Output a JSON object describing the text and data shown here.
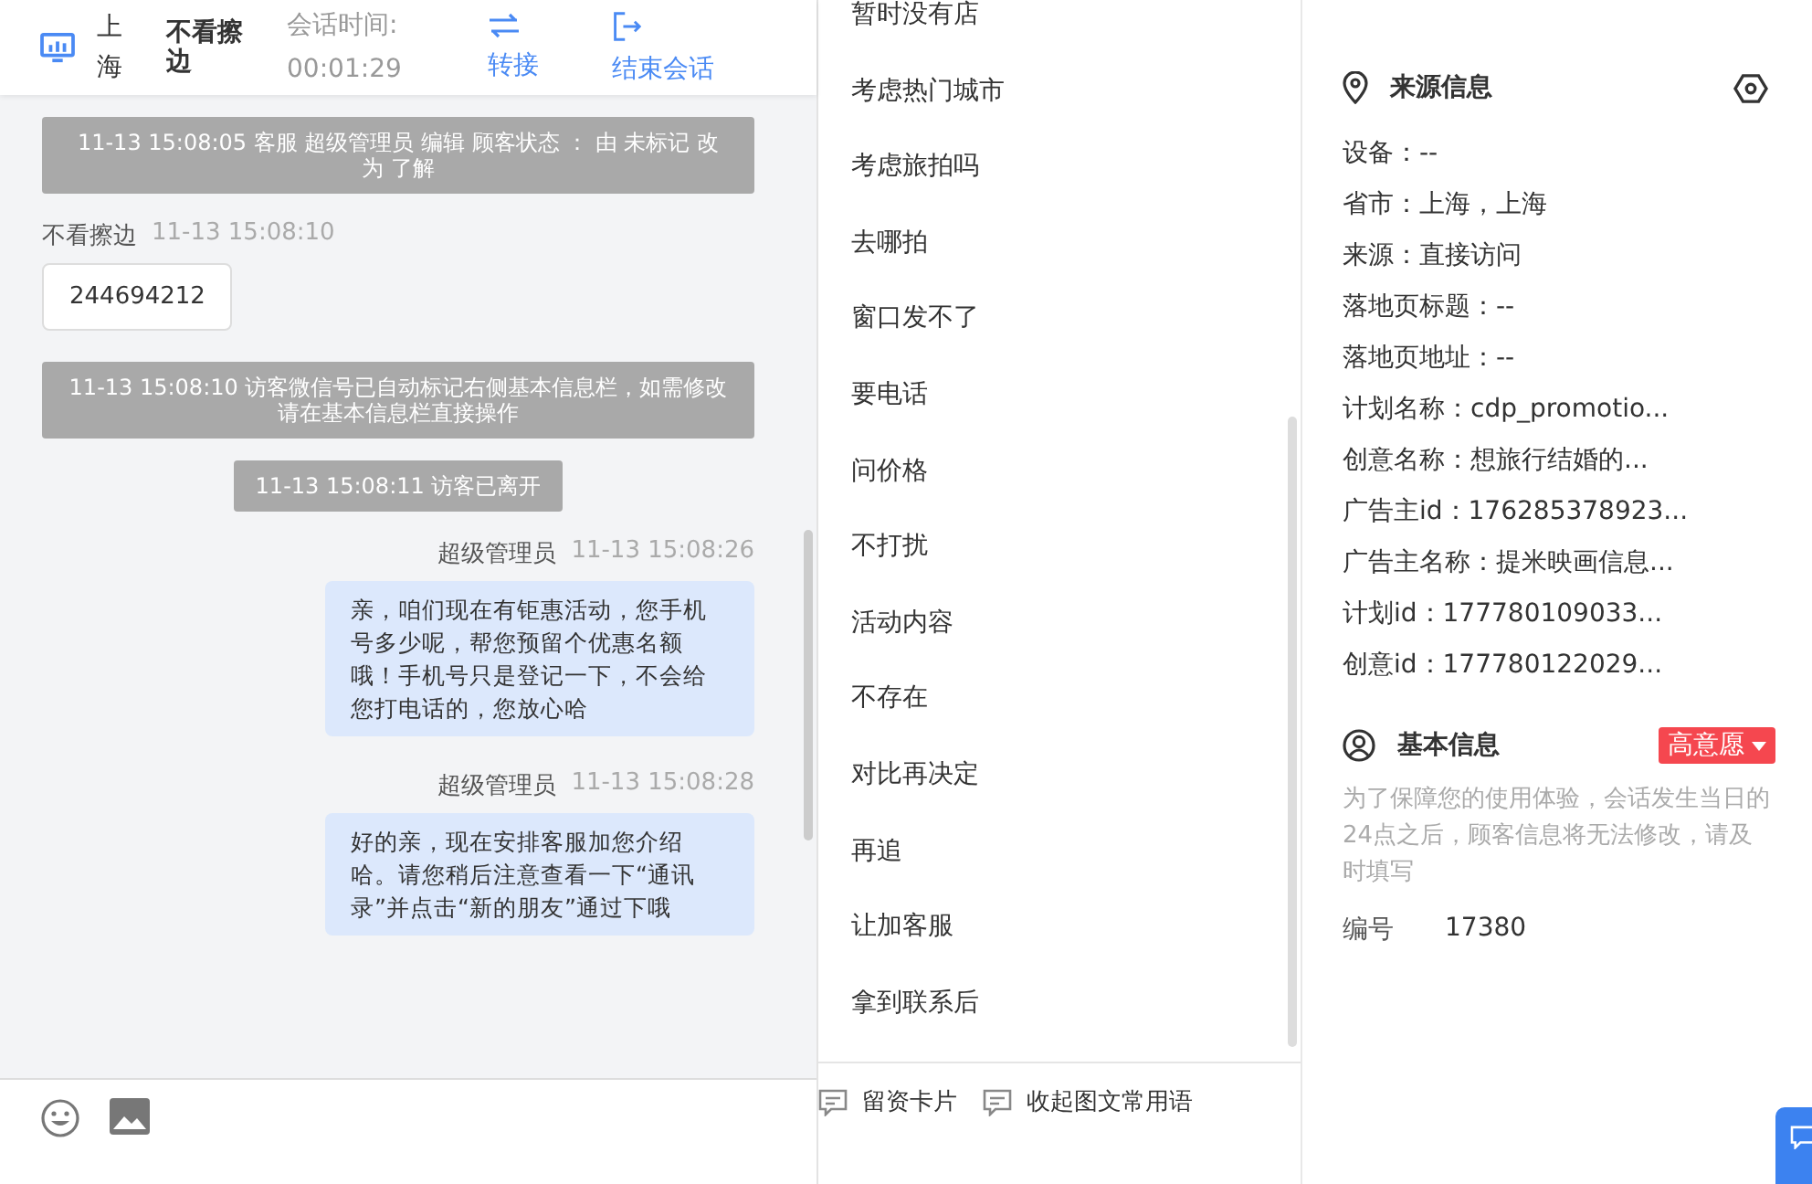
{
  "header": {
    "location": "上海",
    "visitor_name": "不看擦边",
    "duration_label": "会话时间:",
    "duration": "00:01:29",
    "actions": [
      {
        "kind": "transfer",
        "label": "转接"
      },
      {
        "kind": "end",
        "label": "结束会话"
      }
    ]
  },
  "messages": [
    {
      "kind": "system",
      "text": "11-13 15:08:05 客服 超级管理员 编辑 顾客状态 ： 由 未标记 改为 了解"
    },
    {
      "kind": "visitor",
      "sender": "不看擦边",
      "time": "11-13 15:08:10",
      "text": "244694212"
    },
    {
      "kind": "system",
      "text": "11-13 15:08:10 访客微信号已自动标记右侧基本信息栏，如需修改请在基本信息栏直接操作"
    },
    {
      "kind": "system",
      "text": "11-13 15:08:11 访客已离开"
    },
    {
      "kind": "agent",
      "sender": "超级管理员",
      "time": "11-13 15:08:26",
      "text": "亲，咱们现在有钜惠活动，您手机号多少呢，帮您预留个优惠名额哦！手机号只是登记一下，不会给您打电话的，您放心哈"
    },
    {
      "kind": "agent",
      "sender": "超级管理员",
      "time": "11-13 15:08:28",
      "text": "好的亲，现在安排客服加您介绍哈。请您稍后注意查看一下“通讯录”并点击“新的朋友”通过下哦"
    }
  ],
  "quick_replies": [
    "暂时没有店",
    "考虑热门城市",
    "考虑旅拍吗",
    "去哪拍",
    "窗口发不了",
    "要电话",
    "问价格",
    "不打扰",
    "活动内容",
    "不存在",
    "对比再决定",
    "再追",
    "让加客服",
    "拿到联系后"
  ],
  "bottom_actions": [
    "留资卡片",
    "收起图文常用语"
  ],
  "source_info": {
    "title": "来源信息",
    "lines": [
      "设备：--",
      "省市：上海，上海",
      "来源：直接访问",
      "落地页标题：--",
      "落地页地址：--",
      "计划名称：cdp_promotio...",
      "创意名称：想旅行结婚的...",
      "广告主id：176285378923...",
      "广告主名称：提米映画信息...",
      "计划id：177780109033...",
      "创意id：177780122029..."
    ]
  },
  "basic_info": {
    "title": "基本信息",
    "intent_tag": "高意愿",
    "notice": "为了保障您的使用体验，会话发生当日的24点之后，顾客信息将无法修改，请及时填写",
    "fields": [
      {
        "label": "编号",
        "value": "17380"
      }
    ]
  }
}
